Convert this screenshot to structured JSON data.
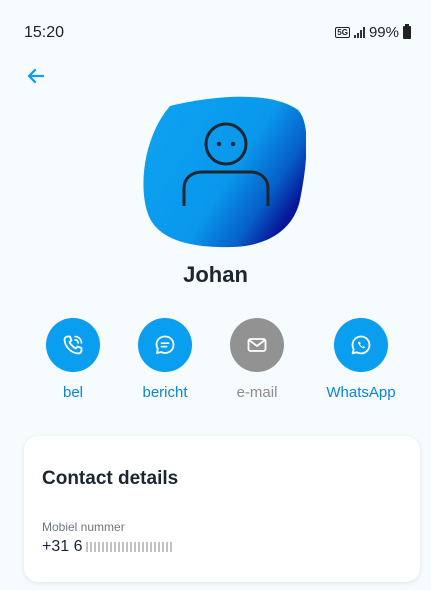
{
  "status_bar": {
    "time": "15:20",
    "network": "5G",
    "battery": "99%"
  },
  "contact": {
    "name": "Johan"
  },
  "actions": [
    {
      "label": "bel",
      "icon": "phone-icon",
      "enabled": true
    },
    {
      "label": "bericht",
      "icon": "chat-icon",
      "enabled": true
    },
    {
      "label": "e-mail",
      "icon": "mail-icon",
      "enabled": false
    },
    {
      "label": "WhatsApp",
      "icon": "whatsapp-icon",
      "enabled": true
    }
  ],
  "details": {
    "title": "Contact details",
    "mobile_label": "Mobiel nummer",
    "mobile_value": "+31 6"
  },
  "colors": {
    "accent": "#0a9ef0",
    "link": "#0a86d6",
    "disabled": "#929292",
    "background": "#f6fbfd"
  }
}
